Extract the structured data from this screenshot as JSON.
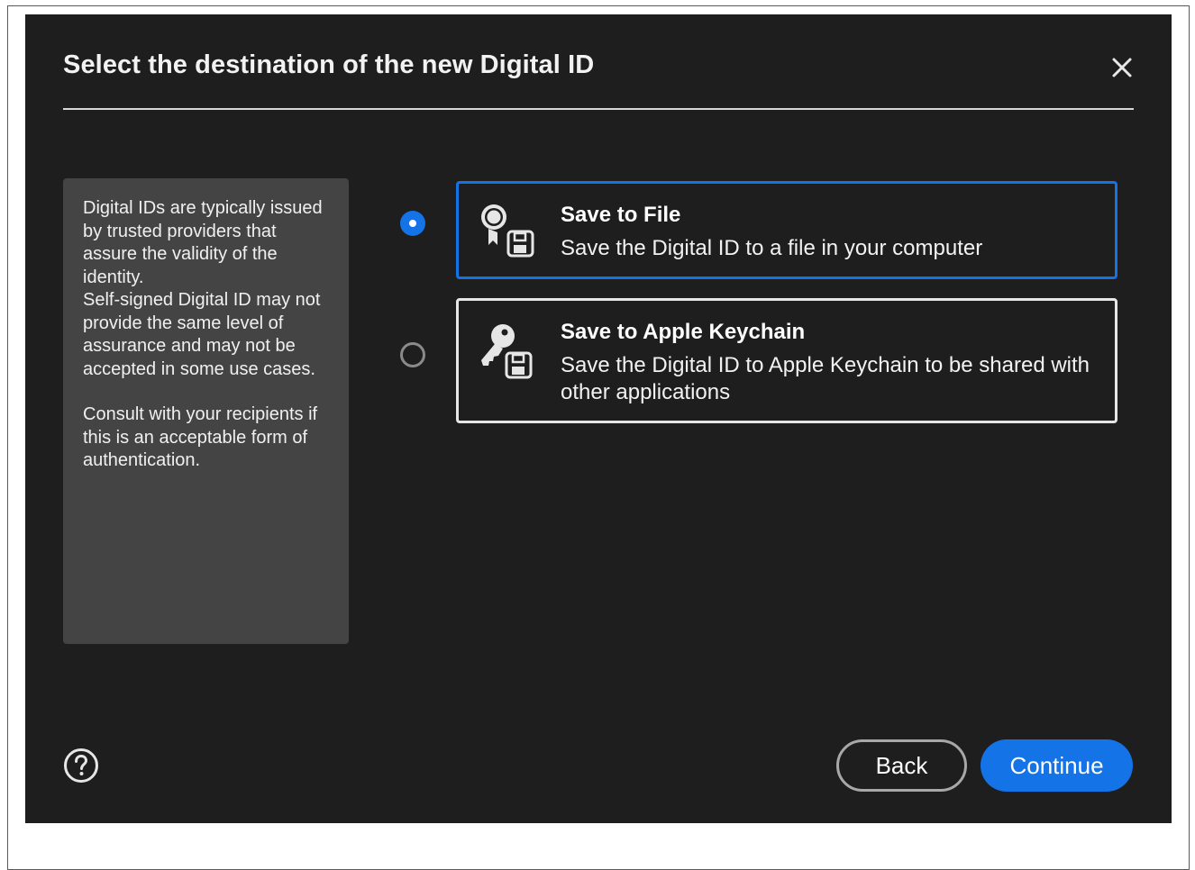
{
  "dialog": {
    "title": "Select the destination of the new Digital ID",
    "close_icon": "close-icon",
    "help_icon": "help-icon"
  },
  "info": {
    "paragraph1": "Digital IDs are typically issued by trusted providers that assure the validity of the identity.",
    "paragraph2": "Self-signed Digital ID may not provide the same level of assurance and may not be accepted in some use cases.",
    "paragraph3": "Consult with your recipients if this is an acceptable form of authentication."
  },
  "options": [
    {
      "title": "Save to File",
      "description": "Save the Digital ID to a file in your computer",
      "icon": "certificate-save-icon",
      "selected": true
    },
    {
      "title": "Save to Apple Keychain",
      "description": "Save the Digital ID to Apple Keychain to be shared with other applications",
      "icon": "key-save-icon",
      "selected": false
    }
  ],
  "buttons": {
    "back_label": "Back",
    "continue_label": "Continue"
  },
  "colors": {
    "accent": "#1473e6",
    "dialog_bg": "#1e1e1e",
    "panel_bg": "#444444"
  }
}
